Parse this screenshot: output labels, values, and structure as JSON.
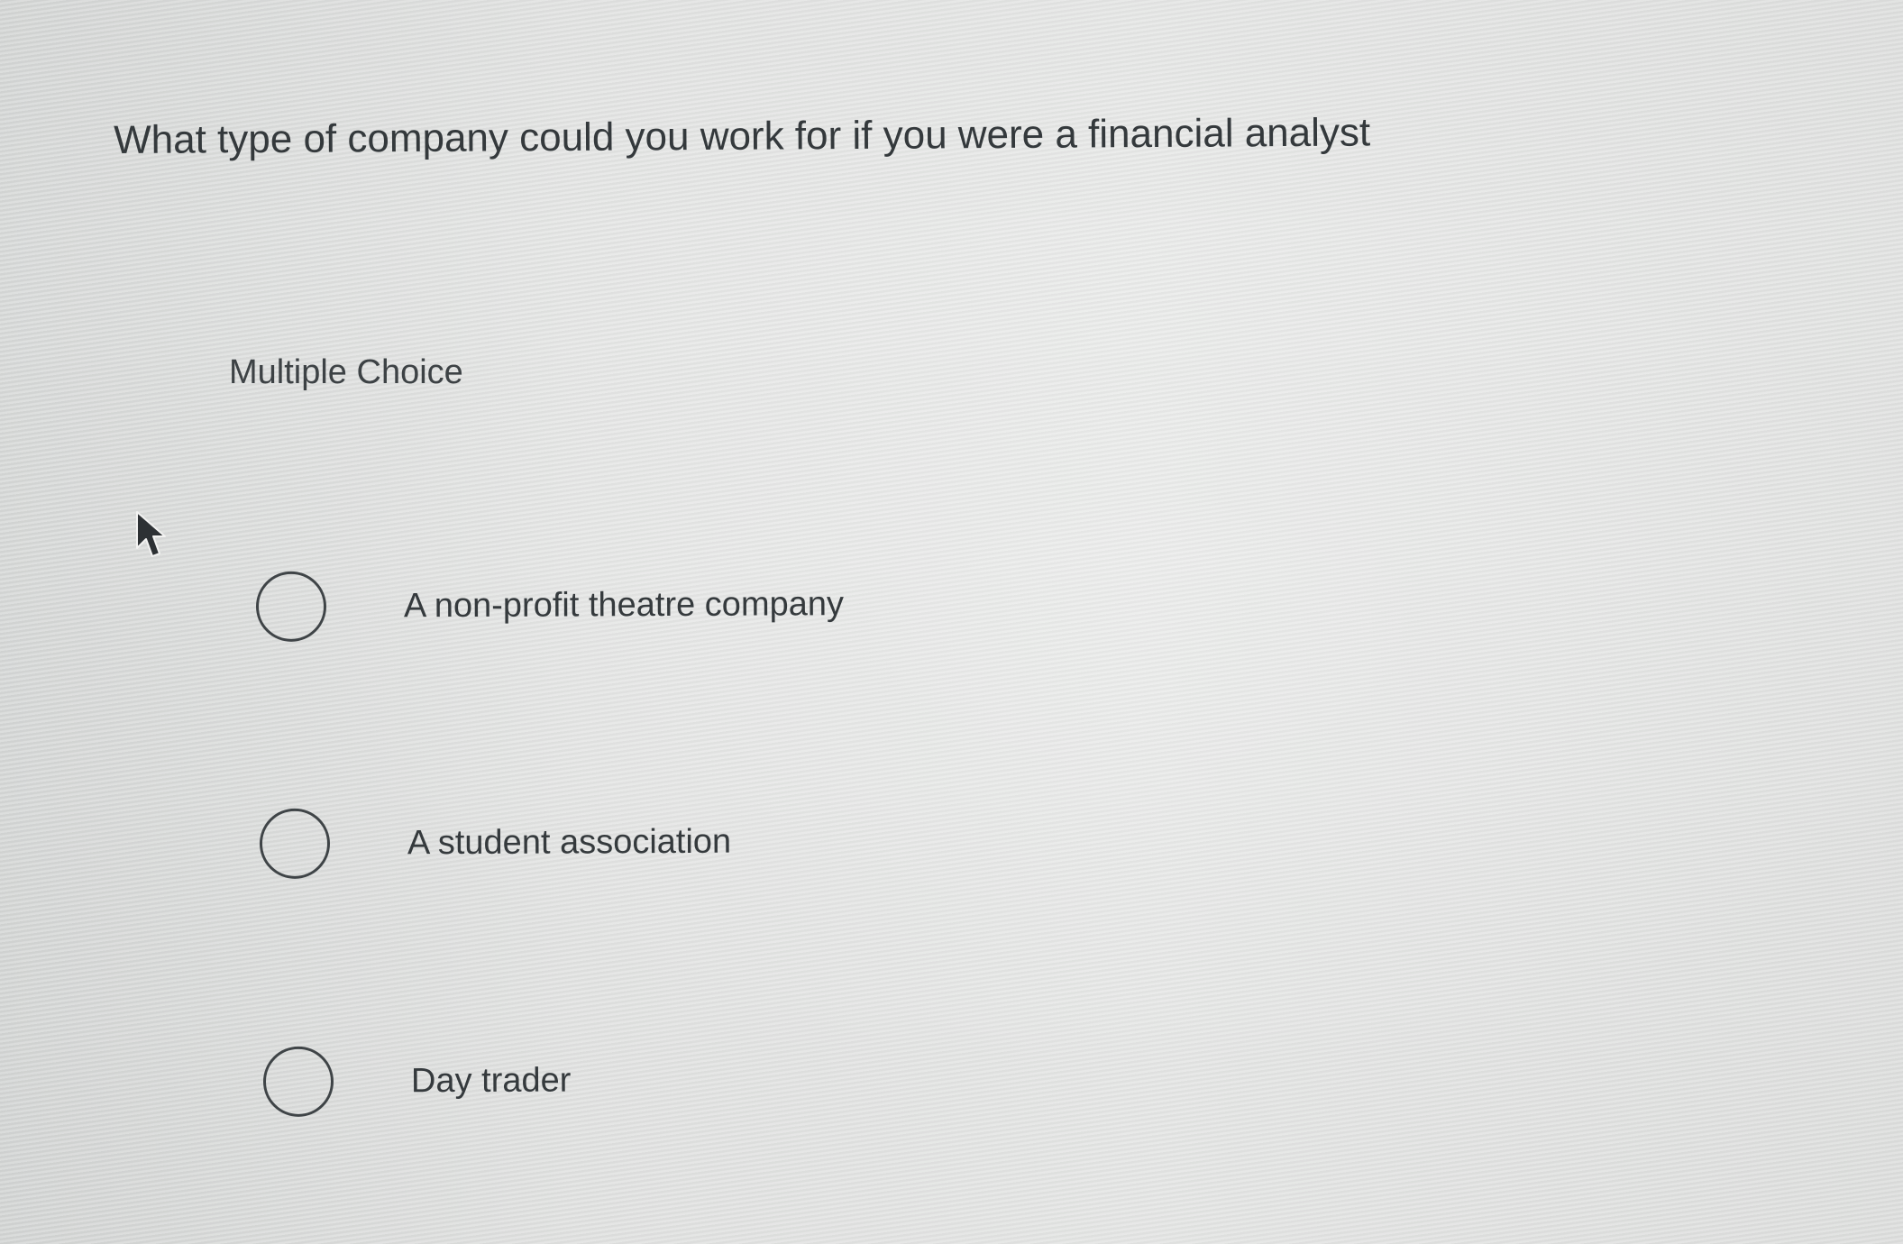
{
  "question": {
    "text": "What type of company could you work for if you were a financial analyst"
  },
  "question_type": "Multiple Choice",
  "choices": [
    {
      "label": "A non-profit theatre company",
      "selected": false
    },
    {
      "label": "A student association",
      "selected": false
    },
    {
      "label": "Day trader",
      "selected": false
    }
  ],
  "icons": {
    "cursor": "mouse-pointer-icon",
    "radio": "radio-button-empty-icon"
  }
}
